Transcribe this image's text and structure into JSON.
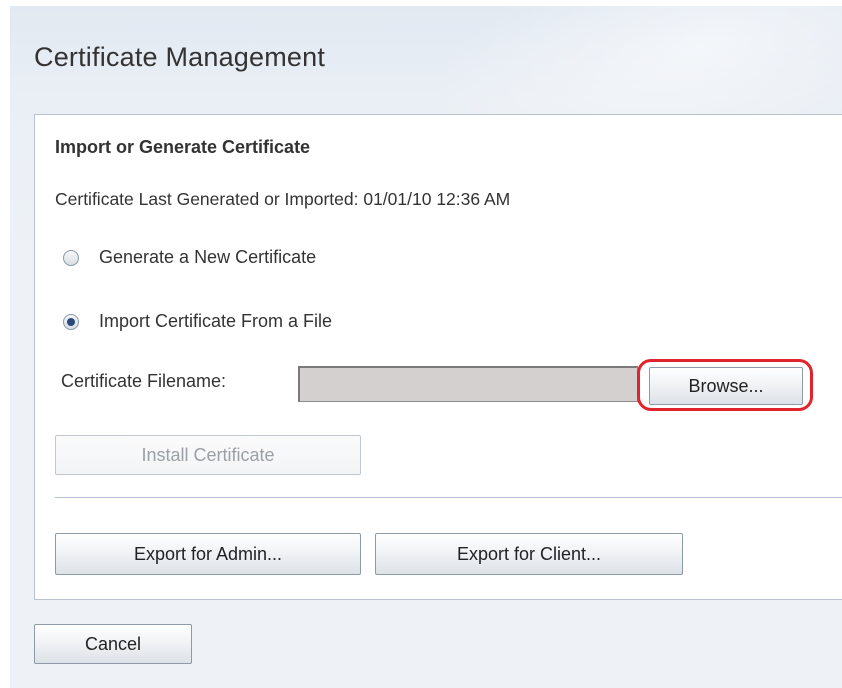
{
  "page": {
    "title": "Certificate Management"
  },
  "section": {
    "title": "Import or Generate Certificate",
    "last_generated": "Certificate Last Generated or Imported: 01/01/10 12:36 AM"
  },
  "options": [
    {
      "label": "Generate a New Certificate",
      "checked": false
    },
    {
      "label": "Import Certificate From a File",
      "checked": true
    }
  ],
  "file": {
    "label": "Certificate Filename:",
    "value": "",
    "browse_label": "Browse..."
  },
  "buttons": {
    "install": "Install Certificate",
    "export_admin": "Export for Admin...",
    "export_client": "Export for Client...",
    "cancel": "Cancel"
  },
  "colors": {
    "highlight": "#e0242e",
    "radio_selected": "#2a4a7a"
  }
}
